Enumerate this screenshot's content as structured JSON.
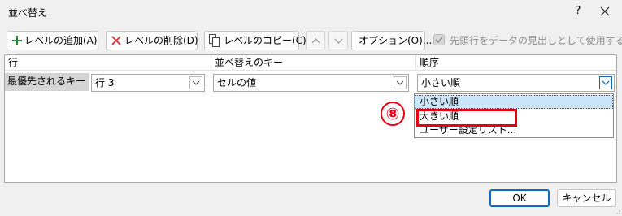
{
  "window": {
    "title": "並べ替え",
    "help_glyph": "?"
  },
  "toolbar": {
    "add_level": "レベルの追加(A)",
    "delete_level": "レベルの削除(D)",
    "copy_level": "レベルのコピー(C)",
    "options": "オプション(O)...",
    "has_headers_label": "先頭行をデータの見出しとして使用する(H)",
    "has_headers_checked": true
  },
  "grid": {
    "headers": {
      "column": "行",
      "sort_on": "並べ替えのキー",
      "order": "順序"
    },
    "row": {
      "label": "最優先されるキー",
      "column_value": "行 3",
      "sort_on_value": "セルの値",
      "order_value": "小さい順"
    }
  },
  "order_dropdown": {
    "options": [
      "小さい順",
      "大きい順",
      "ユーザー設定リスト..."
    ],
    "selected_index": 0
  },
  "annotation": {
    "badge": "⑧"
  },
  "footer": {
    "ok": "OK",
    "cancel": "キャンセル"
  },
  "colors": {
    "accent": "#0f6cbd",
    "annotation_red": "#e60012",
    "selection": "#cce4f7"
  }
}
